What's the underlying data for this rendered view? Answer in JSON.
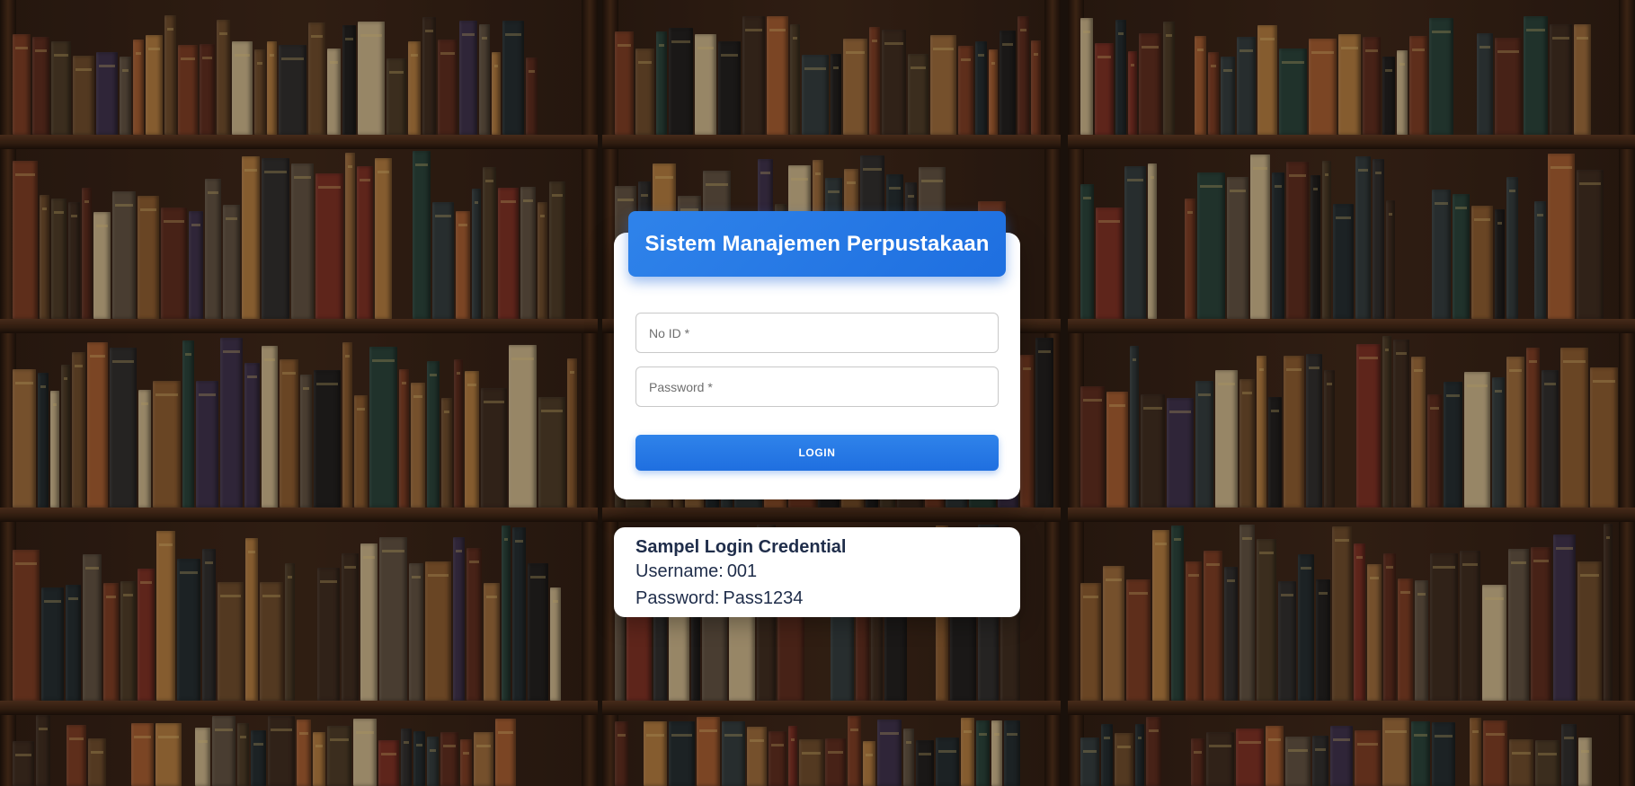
{
  "app": {
    "title": "Sistem Manajemen Perpustakaan"
  },
  "login_form": {
    "id_placeholder": "No ID *",
    "id_value": "",
    "password_placeholder": "Password *",
    "password_value": "",
    "login_label": "LOGIN"
  },
  "sample_credentials": {
    "title": "Sampel Login Credential",
    "username_label": "Username:",
    "username_value": "001",
    "password_label": "Password:",
    "password_value": "Pass1234"
  },
  "colors": {
    "accent": "#1f6fe0",
    "card_bg": "#ffffff",
    "text_dark": "#1f2d4a"
  }
}
